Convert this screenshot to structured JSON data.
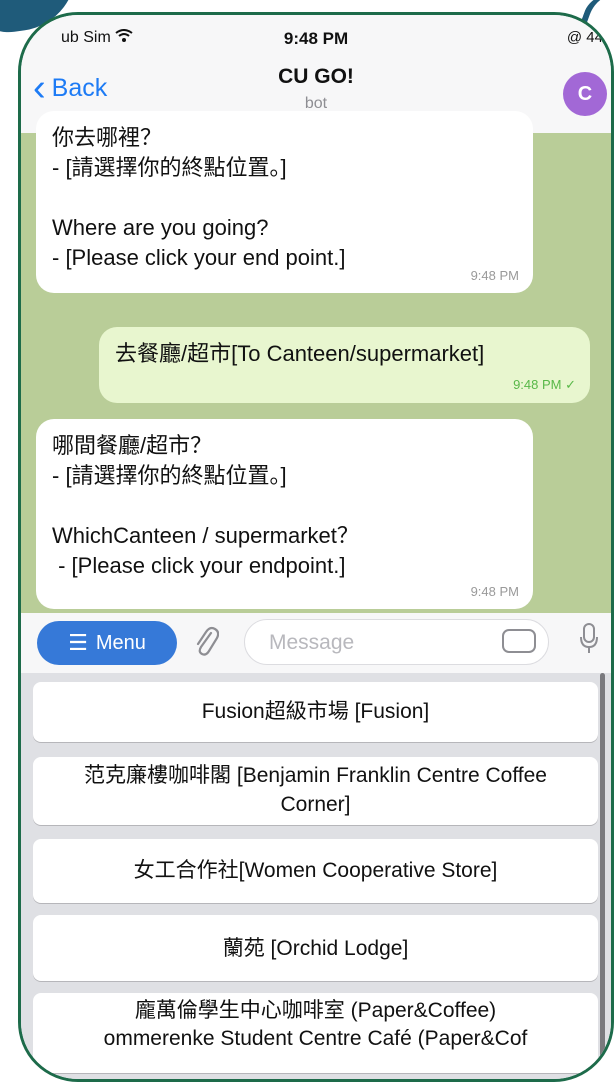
{
  "status_bar": {
    "carrier": "ub Sim",
    "time": "9:48 PM",
    "battery": "@ 44"
  },
  "header": {
    "back_label": "Back",
    "title": "CU GO!",
    "subtitle": "bot",
    "avatar_letter": "C"
  },
  "messages": [
    {
      "direction": "incoming",
      "lines": [
        "你去哪裡？",
        "- [請選擇你的終點位置。]",
        "",
        "Where are you going?",
        "- [Please click your end point.]"
      ],
      "time": "9:48 PM"
    },
    {
      "direction": "outgoing",
      "lines": [
        "去餐廳/超市[To Canteen/supermarket]"
      ],
      "time": "9:48 PM ✓"
    },
    {
      "direction": "incoming",
      "lines": [
        "哪間餐廳/超市？",
        "- [請選擇你的終點位置。]",
        "",
        "WhichCanteen / supermarket？",
        " - [Please click your endpoint.]"
      ],
      "time": "9:48 PM"
    }
  ],
  "input_bar": {
    "menu_label": "Menu",
    "placeholder": "Message"
  },
  "keyboard_buttons": [
    {
      "line1": "Fusion超級市場 [Fusion]",
      "line2": ""
    },
    {
      "line1": "范克廉樓咖啡閣 [Benjamin Franklin Centre Coffee",
      "line2": "Corner]"
    },
    {
      "line1": "女工合作社[Women Cooperative Store]",
      "line2": ""
    },
    {
      "line1": "蘭苑 [Orchid Lodge]",
      "line2": ""
    },
    {
      "line1": "龐萬倫學生中心咖啡室 (Paper&Coffee)",
      "line2": "ommerenke Student Centre Café (Paper&Cof"
    }
  ],
  "colors": {
    "accent": "#1d7bf5",
    "menu_button": "#3679d8",
    "chat_background": "#b9cd98",
    "outgoing_bubble": "#e8f6cf",
    "avatar": "#a268d6",
    "frame_border": "#1d6b4a"
  }
}
